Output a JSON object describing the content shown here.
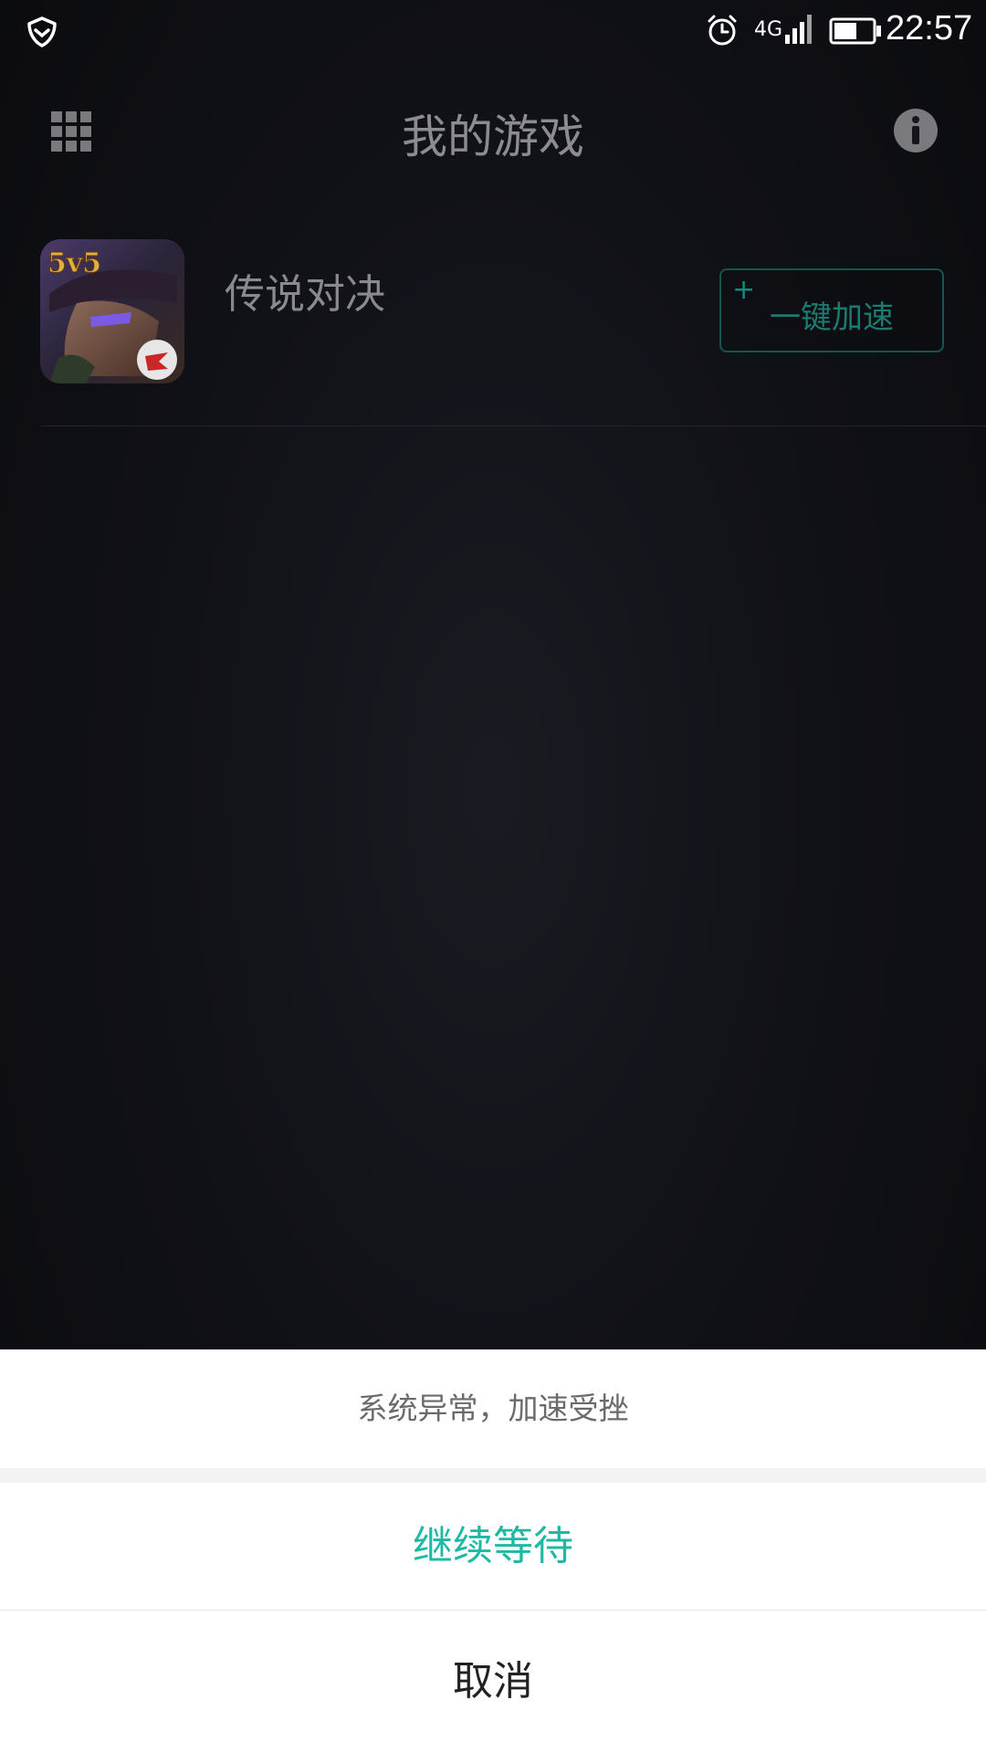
{
  "status_bar": {
    "network": "4G",
    "time": "22:57",
    "icons": [
      "shield-icon",
      "alarm-icon",
      "signal-icon",
      "battery-icon"
    ]
  },
  "header": {
    "title": "我的游戏",
    "left_icon": "grid-icon",
    "right_icon": "info-icon"
  },
  "games": [
    {
      "name": "传说对决",
      "icon_badge": "5v5",
      "action_label": "一键加速",
      "action_prefix": "+"
    }
  ],
  "dialog": {
    "message": "系统异常，加速受挫",
    "confirm_label": "继续等待",
    "cancel_label": "取消"
  },
  "colors": {
    "accent": "#1fb9a3",
    "background": "#111218",
    "sheet": "#ffffff"
  }
}
